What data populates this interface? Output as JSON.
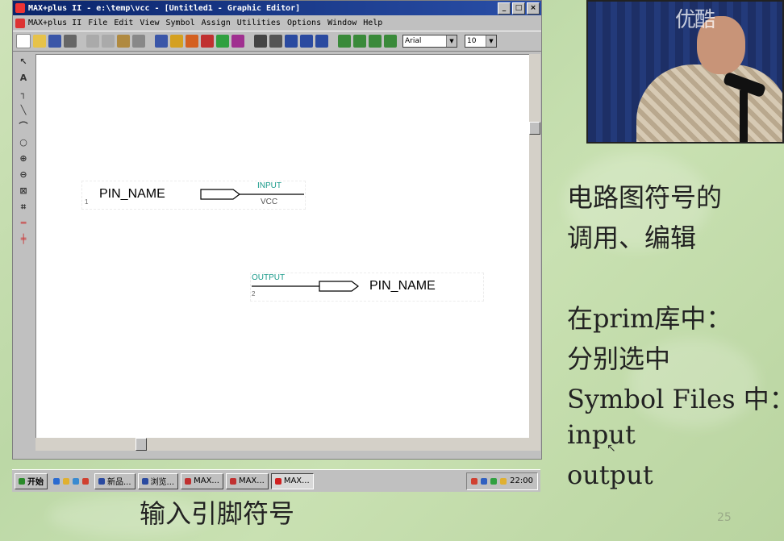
{
  "window": {
    "title": "MAX+plus II - e:\\temp\\vcc - [Untitled1 - Graphic Editor]",
    "min": "_",
    "max": "□",
    "close": "×"
  },
  "menu": [
    "MAX+plus II",
    "File",
    "Edit",
    "View",
    "Symbol",
    "Assign",
    "Utilities",
    "Options",
    "Window",
    "Help"
  ],
  "toolbar": {
    "font_value": "Arial",
    "size_value": "10"
  },
  "canvas": {
    "input_symbol": {
      "pin_name": "PIN_NAME",
      "type_label": "INPUT",
      "vcc_label": "VCC",
      "number": "1"
    },
    "output_symbol": {
      "pin_name": "PIN_NAME",
      "type_label": "OUTPUT",
      "number": "2"
    }
  },
  "taskbar": {
    "start": "开始",
    "tasks": [
      "新品...",
      "浏览...",
      "MAX...",
      "MAX...",
      "MAX..."
    ],
    "time": "22:00"
  },
  "slide": {
    "line1": "电路图符号的",
    "line2": "调用、编辑",
    "line3": "在prim库中：",
    "line4": "分别选中",
    "line5": "Symbol Files 中：",
    "line6": "input",
    "line7": "output",
    "caption": "输入引脚符号",
    "page_number": "25"
  },
  "video": {
    "logo": "优酷"
  },
  "colors": {
    "teal": "#1a9a8a",
    "title_bar": "#0a246a",
    "slide_bg": "#c4dcac"
  }
}
